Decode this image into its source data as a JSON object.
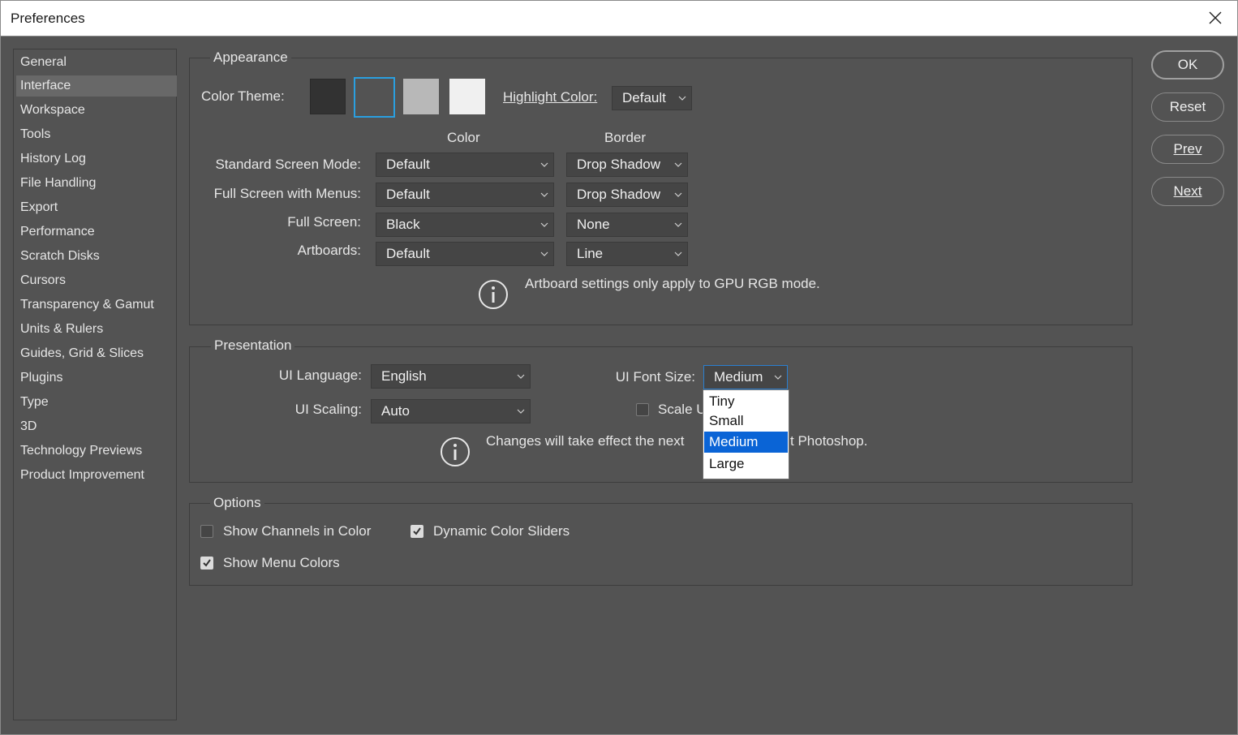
{
  "window": {
    "title": "Preferences"
  },
  "sidebar": {
    "items": [
      {
        "label": "General"
      },
      {
        "label": "Interface"
      },
      {
        "label": "Workspace"
      },
      {
        "label": "Tools"
      },
      {
        "label": "History Log"
      },
      {
        "label": "File Handling"
      },
      {
        "label": "Export"
      },
      {
        "label": "Performance"
      },
      {
        "label": "Scratch Disks"
      },
      {
        "label": "Cursors"
      },
      {
        "label": "Transparency & Gamut"
      },
      {
        "label": "Units & Rulers"
      },
      {
        "label": "Guides, Grid & Slices"
      },
      {
        "label": "Plugins"
      },
      {
        "label": "Type"
      },
      {
        "label": "3D"
      },
      {
        "label": "Technology Previews"
      },
      {
        "label": "Product Improvement"
      }
    ],
    "selected": "Interface"
  },
  "appearance": {
    "legend": "Appearance",
    "color_theme_label": "Color Theme:",
    "themes": [
      {
        "name": "darkest",
        "color": "#323232"
      },
      {
        "name": "dark",
        "color": "#535353",
        "selected": true
      },
      {
        "name": "medium-gray",
        "color": "#b8b8b8"
      },
      {
        "name": "light",
        "color": "#f0f0f0"
      }
    ],
    "highlight_label": "Highlight Color:",
    "highlight_value": "Default",
    "col_color": "Color",
    "col_border": "Border",
    "rows": [
      {
        "label": "Standard Screen Mode:",
        "color": "Default",
        "border": "Drop Shadow"
      },
      {
        "label": "Full Screen with Menus:",
        "color": "Default",
        "border": "Drop Shadow"
      },
      {
        "label": "Full Screen:",
        "color": "Black",
        "border": "None"
      },
      {
        "label": "Artboards:",
        "color": "Default",
        "border": "Line"
      }
    ],
    "info": "Artboard settings only apply to GPU RGB mode."
  },
  "presentation": {
    "legend": "Presentation",
    "language_label": "UI Language:",
    "language_value": "English",
    "scaling_label": "UI Scaling:",
    "scaling_value": "Auto",
    "font_size_label": "UI Font Size:",
    "font_size_value": "Medium",
    "scale_label": "Scale U",
    "info_left": "Changes will take effect the next",
    "info_right": "t Photoshop.",
    "font_size_options": [
      "Tiny",
      "Small",
      "Medium",
      "Large"
    ],
    "highlighted_option": "Medium"
  },
  "options": {
    "legend": "Options",
    "show_channels": {
      "label": "Show Channels in Color",
      "checked": false
    },
    "dynamic_sliders": {
      "label": "Dynamic Color Sliders",
      "checked": true
    },
    "show_menu_colors": {
      "label": "Show Menu Colors",
      "checked": true
    }
  },
  "buttons": {
    "ok": "OK",
    "reset": "Reset",
    "prev": "Prev",
    "next": "Next"
  },
  "colors": {
    "accent": "#0a64d6",
    "panel": "#535353",
    "theme_selected_border": "#2a9fe0"
  }
}
